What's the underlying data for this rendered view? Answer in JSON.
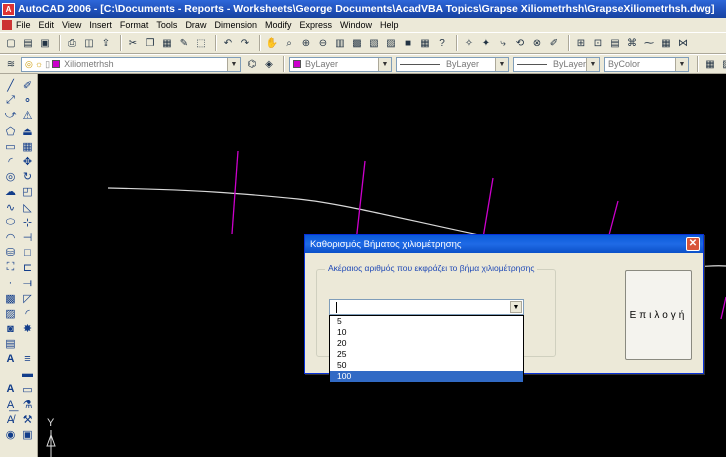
{
  "window": {
    "title": "AutoCAD 2006 - [C:\\Documents - Reports - Worksheets\\George Documents\\AcadVBA Topics\\Grapse Xiliometrhsh\\GrapseXiliometrhsh.dwg]"
  },
  "menu": [
    "File",
    "Edit",
    "View",
    "Insert",
    "Format",
    "Tools",
    "Draw",
    "Dimension",
    "Modify",
    "Express",
    "Window",
    "Help"
  ],
  "layers_toolbar": {
    "layer_name": "Xiliometrhsh",
    "color": "ByLayer",
    "linetype": "ByLayer",
    "lineweight": "ByLayer",
    "plotstyle": "ByColor"
  },
  "dialog": {
    "title": "Καθορισμός Βήματος χιλιομέτρησης",
    "group_label": "Ακέραιος αριθμός που εκφράζει το βήμα χιλιομέτρησης",
    "combo_value": "",
    "options": [
      "5",
      "10",
      "20",
      "25",
      "50",
      "100"
    ],
    "selected": "100",
    "select_button": "Επιλογή"
  },
  "ucs": {
    "y_label": "Y"
  },
  "colors": {
    "layer_swatch": "#cc00cc",
    "polyline": "#d8d8d8",
    "ticks": "#cc00cc",
    "selection": "#316ac5"
  }
}
